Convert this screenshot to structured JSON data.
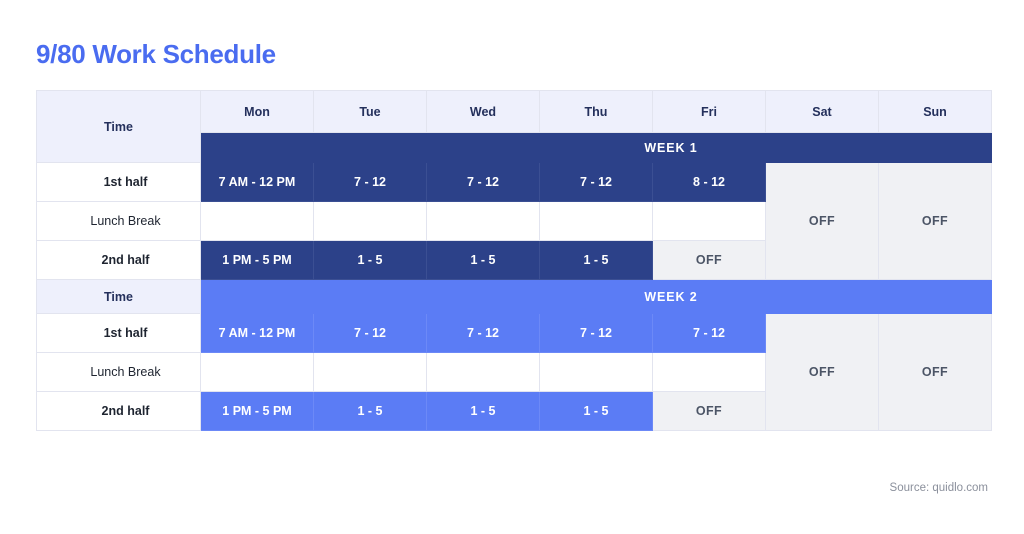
{
  "title": "9/80 Work Schedule",
  "source": "Source: quidlo.com",
  "colors": {
    "title_blue": "#4a6cf0",
    "week1_navy": "#2c4189",
    "week2_blue": "#5b7cf5",
    "header_lavender": "#eef0fc",
    "off_gray": "#f0f1f4",
    "text_navy": "#24305c"
  },
  "table": {
    "time_header": "Time",
    "day_headers": [
      "Mon",
      "Tue",
      "Wed",
      "Thu",
      "Fri",
      "Sat",
      "Sun"
    ],
    "row_labels": {
      "first_half": "1st half",
      "lunch": "Lunch Break",
      "second_half": "2nd half"
    },
    "off_label": "OFF",
    "weeks": [
      {
        "band_label": "WEEK 1",
        "first_half": [
          "7 AM - 12 PM",
          "7 - 12",
          "7 - 12",
          "7 - 12",
          "8 - 12"
        ],
        "lunch": [
          "",
          "",
          "",
          "",
          ""
        ],
        "second_half": [
          "1 PM - 5 PM",
          "1 - 5",
          "1 - 5",
          "1 - 5",
          "OFF"
        ],
        "second_half_fri_off": true,
        "saturday": "OFF",
        "sunday": "OFF"
      },
      {
        "band_label": "WEEK 2",
        "first_half": [
          "7 AM - 12 PM",
          "7 - 12",
          "7 - 12",
          "7 - 12",
          "7 - 12"
        ],
        "lunch": [
          "",
          "",
          "",
          "",
          ""
        ],
        "second_half": [
          "1 PM - 5 PM",
          "1 - 5",
          "1 - 5",
          "1 - 5",
          "OFF"
        ],
        "second_half_fri_off": true,
        "saturday": "OFF",
        "sunday": "OFF"
      }
    ]
  }
}
